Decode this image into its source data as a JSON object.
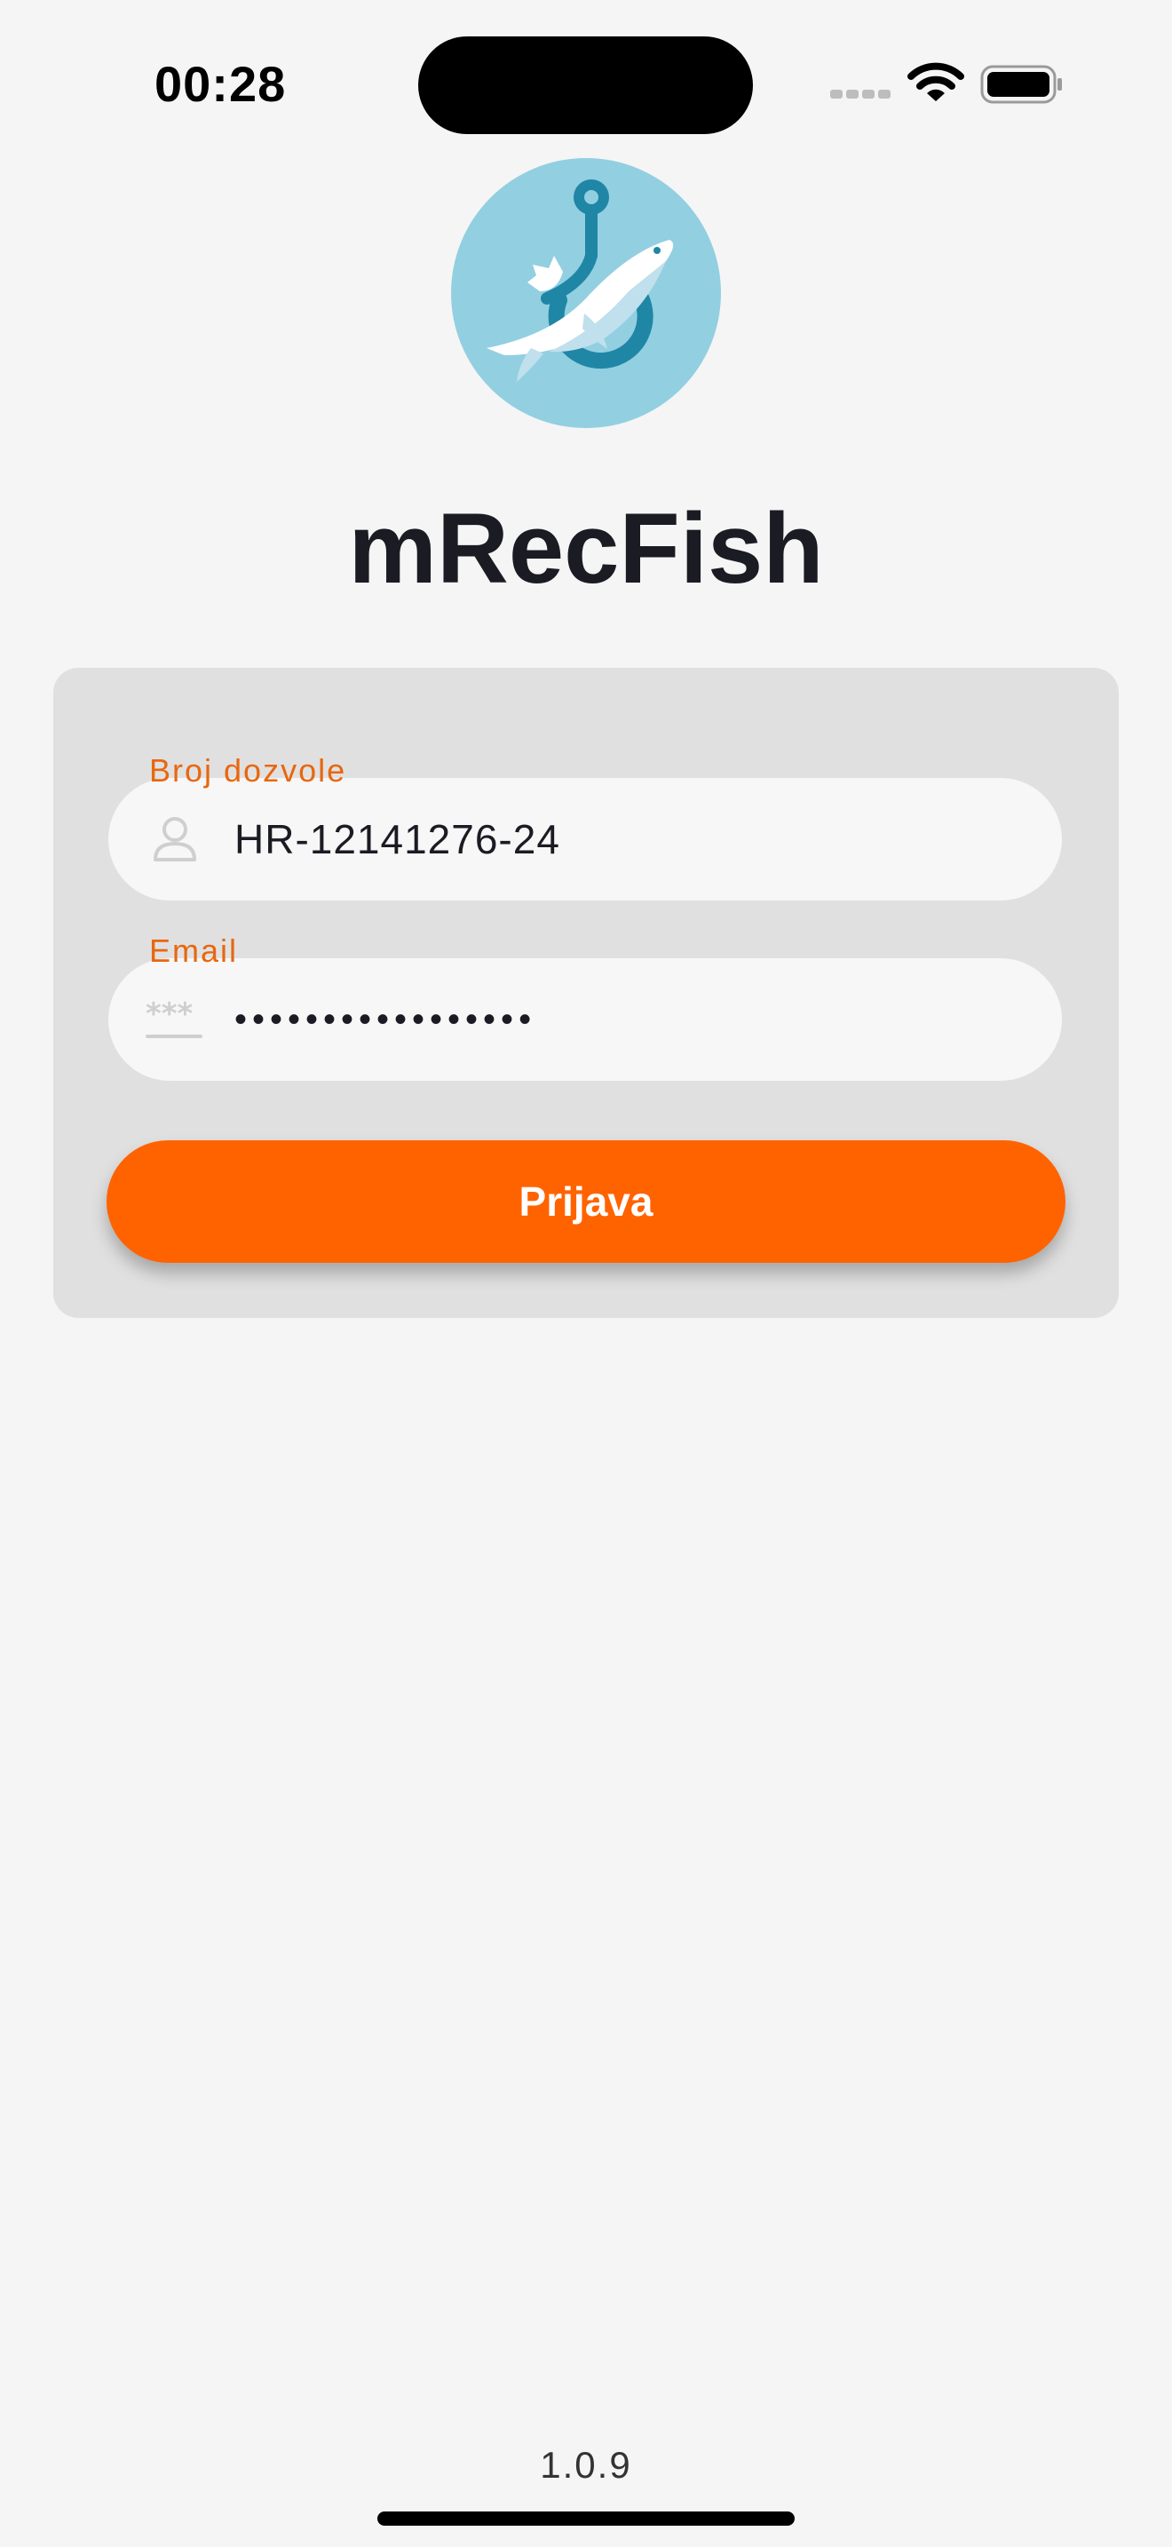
{
  "status_bar": {
    "time": "00:28",
    "icons": [
      "signal-dots-icon",
      "wifi-icon",
      "battery-icon"
    ]
  },
  "app": {
    "title": "mRecFish",
    "logo_icon": "fish-hook-logo-icon",
    "version": "1.0.9"
  },
  "login_form": {
    "permit_field": {
      "label": "Broj dozvole",
      "value": "HR-12141276-24",
      "icon": "user-icon"
    },
    "email_field": {
      "label": "Email",
      "value": "•••••••••••••••••",
      "icon": "password-asterisk-icon"
    },
    "submit_label": "Prijava"
  },
  "colors": {
    "accent": "#ff6300",
    "label": "#e8670f",
    "card": "#e0e0e0",
    "background": "#f5f5f5",
    "logo_circle": "#92cfe1",
    "logo_hook": "#1f86a6"
  }
}
